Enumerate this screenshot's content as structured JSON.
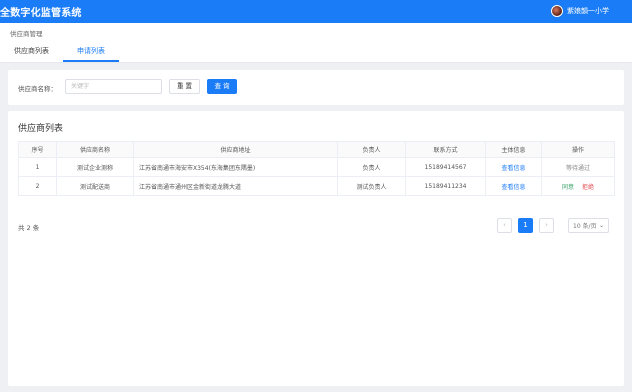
{
  "header": {
    "app_title": "全数字化监管系统",
    "user_name": "紫娘韻一小学"
  },
  "breadcrumb": "供应商管理",
  "tabs": [
    {
      "label": "供应商列表",
      "active": false
    },
    {
      "label": "申请列表",
      "active": true
    }
  ],
  "search": {
    "label": "供应商名称：",
    "placeholder": "关键字",
    "value": "",
    "reset_label": "重 置",
    "query_label": "查 询"
  },
  "list": {
    "title": "供应商列表",
    "columns": [
      "序号",
      "供应商名称",
      "供应商地址",
      "负责人",
      "联系方式",
      "主体信息",
      "操作"
    ],
    "rows": [
      {
        "index": "1",
        "name": "测试企业测称",
        "address": "江苏省南通市海安市X354(东海集团东隅墨)",
        "contact": "负责人",
        "phone": "15189414567",
        "info_link": "查看信息",
        "status": "等待通过"
      },
      {
        "index": "2",
        "name": "测试配送商",
        "address": "江苏省南通市通州区金新街道龙腾大道",
        "contact": "测试负责人",
        "phone": "15189411234",
        "info_link": "查看信息",
        "approve": "同意",
        "reject": "拒绝"
      }
    ],
    "total_text": "共 2 条"
  },
  "pagination": {
    "prev": "‹",
    "current_page": "1",
    "next": "›",
    "page_size": "10 条/页",
    "page_size_arrow": "⌄"
  },
  "colors": {
    "primary": "#1a7cf6",
    "approve": "#38a169",
    "reject": "#e5484d"
  }
}
